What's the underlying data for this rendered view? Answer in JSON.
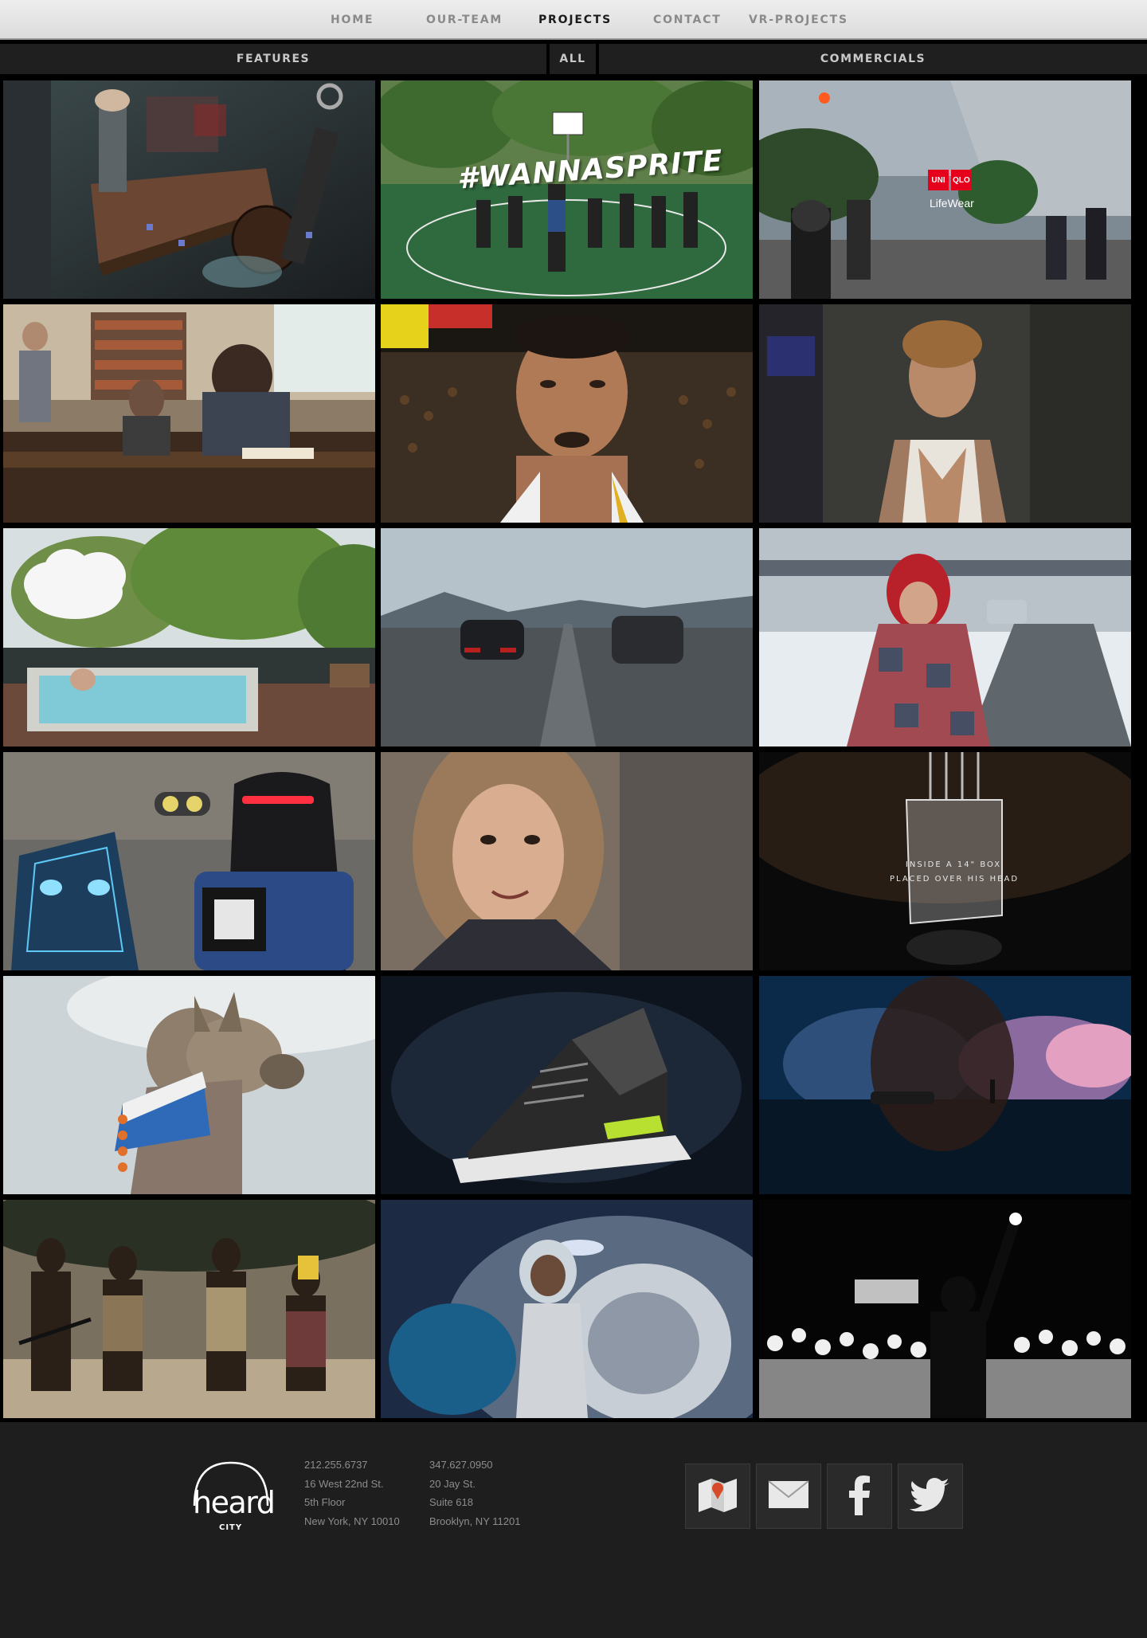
{
  "nav": {
    "home": "HOME",
    "team": "OUR-TEAM",
    "projects": "PROJECTS",
    "contact": "CONTACT",
    "vr": "VR-PROJECTS"
  },
  "filters": {
    "features": "FEATURES",
    "all": "ALL",
    "commercials": "COMMERCIALS"
  },
  "tiles": {
    "sprite": "#WANNASPRITE",
    "uniqlo_top": "UNI",
    "uniqlo_mid": "QLO",
    "uniqlo_tag": "LifeWear",
    "box_line1": "INSIDE A 14\" BOX",
    "box_line2": "PLACED OVER HIS HEAD"
  },
  "footer": {
    "logo_word": "heard",
    "logo_sub": "CITY",
    "office1": [
      "212.255.6737",
      "16 West 22nd St.",
      "5th Floor",
      "New York, NY 10010"
    ],
    "office2": [
      "347.627.0950",
      "20 Jay St.",
      "Suite 618",
      "Brooklyn, NY 11201"
    ],
    "social_icons": [
      "map-icon",
      "mail-icon",
      "facebook-icon",
      "twitter-icon"
    ]
  },
  "colors": {
    "nav_bg": "#e4e4e4",
    "active": "#1a1a1a",
    "footer_bg": "#1e1e1e",
    "uniqlo_red": "#e5001c"
  }
}
